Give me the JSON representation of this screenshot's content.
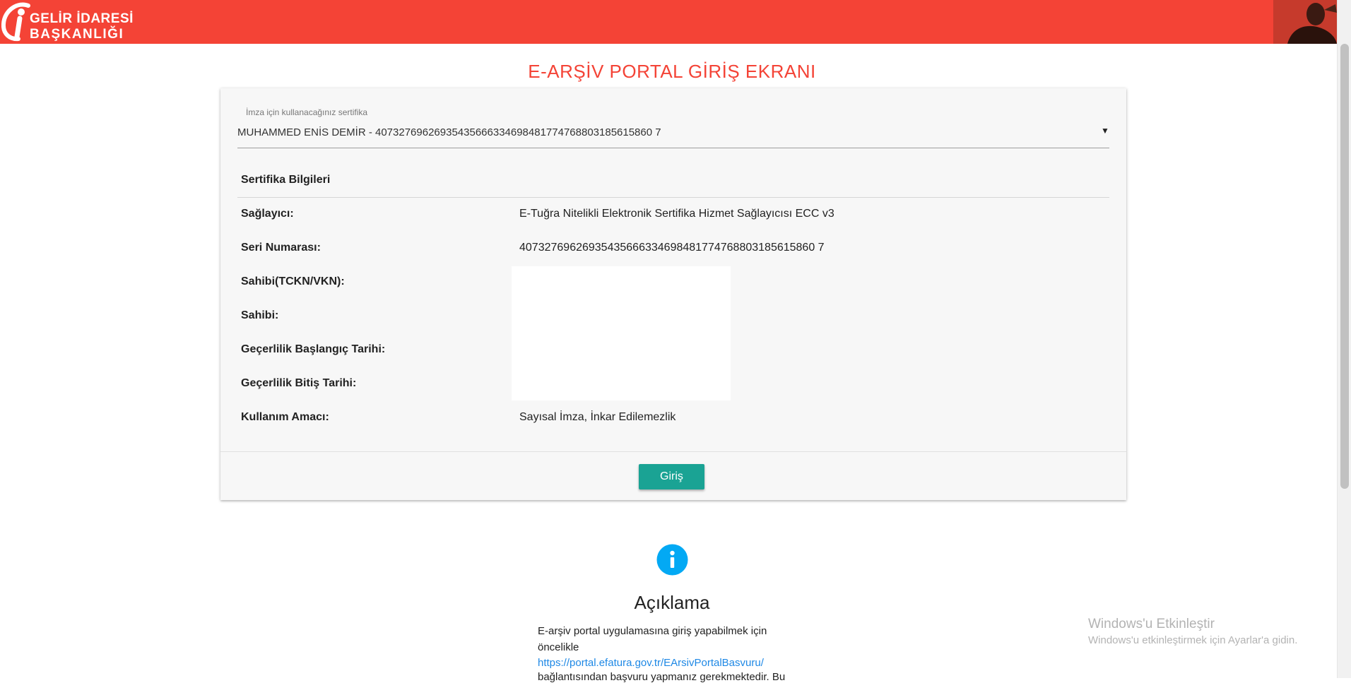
{
  "header": {
    "logo_line1": "GELİR İDARESİ",
    "logo_line2": "BAŞKANLIĞI",
    "bg_color": "#f44336"
  },
  "page_title": "E-ARŞİV PORTAL GİRİŞ EKRANI",
  "certificate_select": {
    "label": "İmza için kullanacağınız sertifika",
    "value": "MUHAMMED ENİS DEMİR - 40732769626935435666334698481774768803185615860 7",
    "arrow": "▼"
  },
  "cert_info": {
    "title": "Sertifika Bilgileri",
    "rows": [
      {
        "label": "Sağlayıcı:",
        "value": "E-Tuğra Nitelikli Elektronik Sertifika Hizmet Sağlayıcısı ECC v3"
      },
      {
        "label": "Seri Numarası:",
        "value": "40732769626935435666334698481774768803185615860 7"
      },
      {
        "label": "Sahibi(TCKN/VKN):",
        "value": ""
      },
      {
        "label": "Sahibi:",
        "value": ""
      },
      {
        "label": "Geçerlilik Başlangıç Tarihi:",
        "value": ""
      },
      {
        "label": "Geçerlilik Bitiş Tarihi:",
        "value": ""
      },
      {
        "label": "Kullanım Amacı:",
        "value": "Sayısal İmza, İnkar Edilemezlik"
      }
    ]
  },
  "login_button": {
    "label": "Giriş",
    "color": "#1aa394"
  },
  "info": {
    "icon": "info-icon",
    "icon_color": "#03a9f4",
    "title": "Açıklama",
    "line1": "E-arşiv portal uygulamasına giriş yapabilmek için",
    "line2": "öncelikle",
    "link": "https://portal.efatura.gov.tr/EArsivPortalBasvuru/",
    "line3": "bağlantısından başvuru yapmanız gerekmektedir. Bu"
  },
  "watermark": {
    "title": "Windows'u Etkinleştir",
    "subtitle": "Windows'u etkinleştirmek için Ayarlar'a gidin."
  }
}
